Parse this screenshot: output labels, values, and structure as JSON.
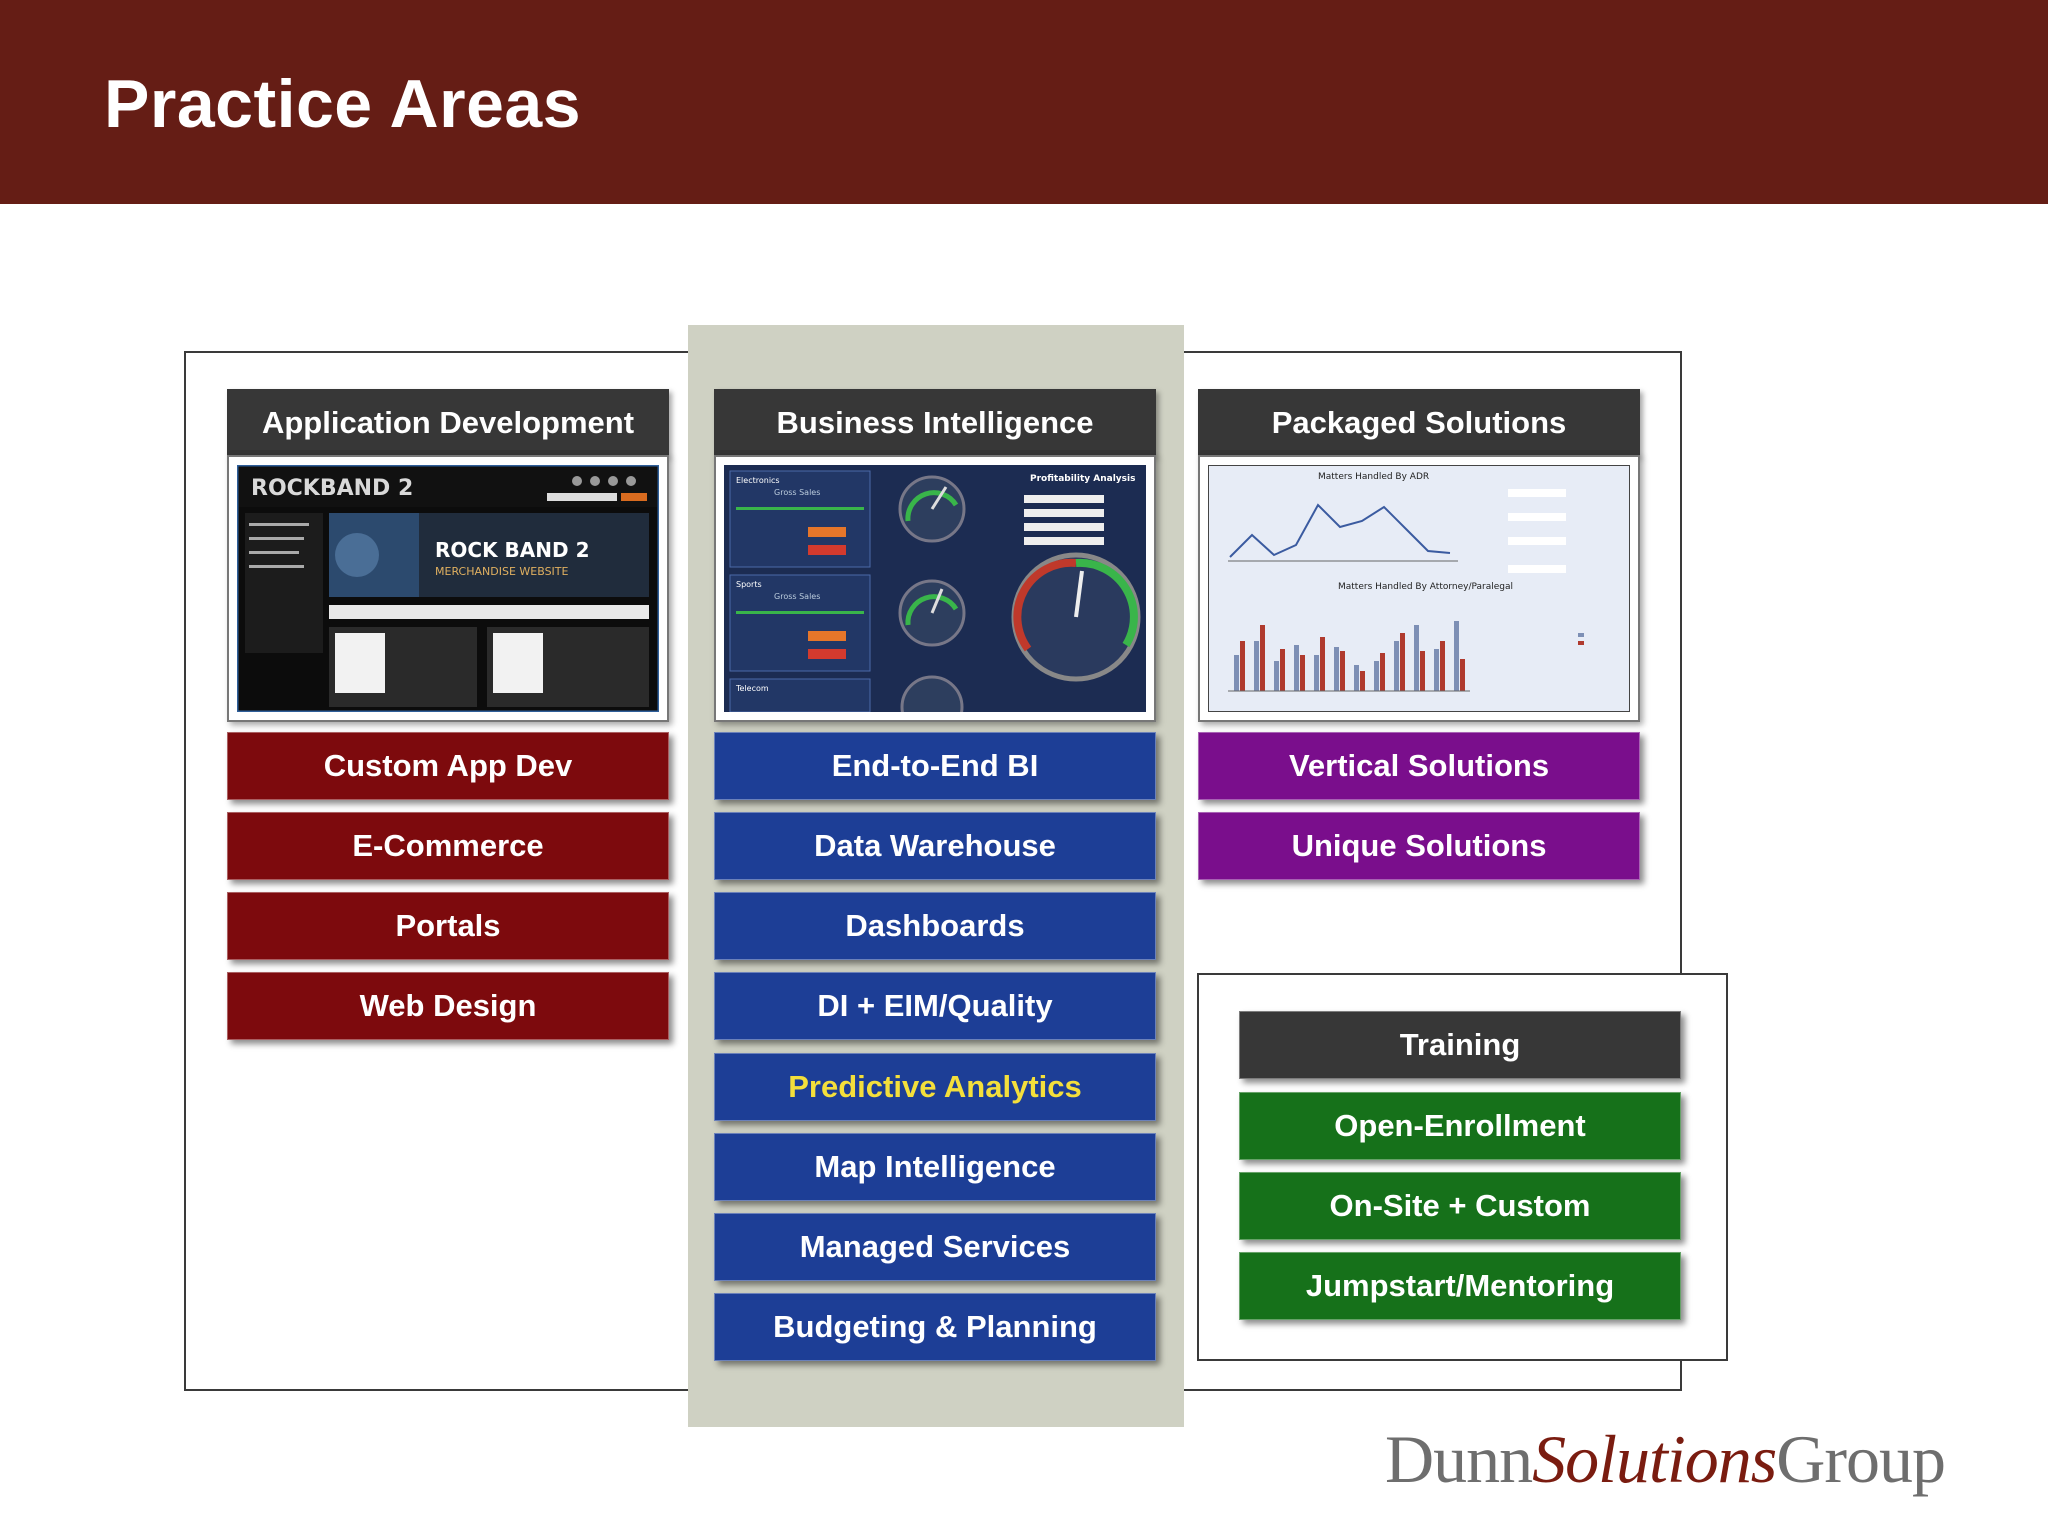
{
  "header": {
    "title": "Practice Areas"
  },
  "columns": {
    "app_dev": {
      "title": "Application Development",
      "thumbnail": {
        "logo": "ROCKBAND 2",
        "banner_line1": "ROCK BAND 2",
        "banner_line2": "MERCHANDISE WEBSITE"
      },
      "items": [
        "Custom App Dev",
        "E-Commerce",
        "Portals",
        "Web Design"
      ]
    },
    "bi": {
      "title": "Business Intelligence",
      "thumbnail": {
        "panel_title": "Profitability Analysis",
        "sections": [
          "Electronics",
          "Sports",
          "Telecom"
        ],
        "metric": "Gross Sales"
      },
      "items": [
        "End-to-End BI",
        "Data Warehouse",
        "Dashboards",
        "DI + EIM/Quality",
        "Predictive Analytics",
        "Map Intelligence",
        "Managed Services",
        "Budgeting & Planning"
      ]
    },
    "packaged": {
      "title": "Packaged Solutions",
      "thumbnail": {
        "chart1_title": "Matters Handled By ADR",
        "chart2_title": "Matters Handled By Attorney/Paralegal"
      },
      "items": [
        "Vertical Solutions",
        "Unique Solutions"
      ]
    }
  },
  "training": {
    "title": "Training",
    "items": [
      "Open-Enrollment",
      "On-Site + Custom",
      "Jumpstart/Mentoring"
    ]
  },
  "logo": {
    "part1": "Dunn",
    "part2": "Solutions",
    "part3": "Group"
  },
  "colors": {
    "header": "#651d15",
    "app_dev": "#7d0a0d",
    "bi": "#1d3e96",
    "packaged": "#7a0e8c",
    "training": "#16711a",
    "highlight": "#f4df3b"
  }
}
